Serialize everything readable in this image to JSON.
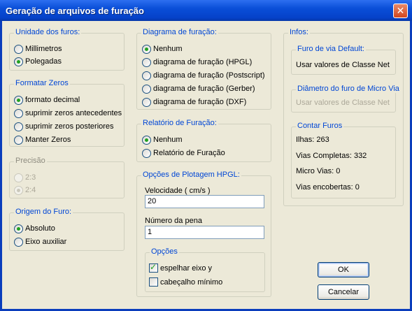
{
  "window": {
    "title": "Geração de arquivos de furação",
    "close_glyph": "✕"
  },
  "unidade": {
    "legend": "Unidade dos furos:",
    "options": [
      "Millimetros",
      "Polegadas"
    ],
    "selected": 1
  },
  "formatar": {
    "legend": "Formatar Zeros",
    "options": [
      "formato decimal",
      "suprimir zeros antecedentes",
      "suprimir zeros posteriores",
      "Manter Zeros"
    ],
    "selected": 0
  },
  "precisao": {
    "legend": "Precisão",
    "options": [
      "2:3",
      "2:4"
    ],
    "selected": 1,
    "disabled": true
  },
  "origem": {
    "legend": "Origem do Furo:",
    "options": [
      "Absoluto",
      "Eixo auxiliar"
    ],
    "selected": 0
  },
  "diagrama": {
    "legend": "Diagrama de furação:",
    "options": [
      "Nenhum",
      "diagrama de furação (HPGL)",
      "diagrama de furação (Postscript)",
      "diagrama de furação (Gerber)",
      "diagrama de furação (DXF)"
    ],
    "selected": 0
  },
  "relatorio": {
    "legend": "Relatório de Furação:",
    "options": [
      "Nenhum",
      "Relatório de Furação"
    ],
    "selected": 0
  },
  "hpgl": {
    "legend": "Opções de Plotagem HPGL:",
    "velocidade_label": "Velocidade ( cm/s )",
    "velocidade_value": "20",
    "pena_label": "Número da pena",
    "pena_value": "1",
    "opcoes_legend": "Opções",
    "espelhar_label": "espelhar eixo y",
    "espelhar_checked": true,
    "cabecalho_label": "cabeçalho mínimo",
    "cabecalho_checked": false
  },
  "infos": {
    "legend": "Infos:",
    "furo_legend": "Furo de via  Default:",
    "furo_text": "Usar valores de Classe Net",
    "micro_legend": "Diâmetro do furo de Micro Via",
    "micro_text": "Usar valores de Classe Net",
    "contar_legend": "Contar Furos",
    "ilhas": "Ilhas: 263",
    "vias_completas": "Vias Completas: 332",
    "micro_vias": "Micro Vias: 0",
    "vias_encobertas": "Vias encobertas: 0"
  },
  "buttons": {
    "ok": "OK",
    "cancelar": "Cancelar"
  }
}
